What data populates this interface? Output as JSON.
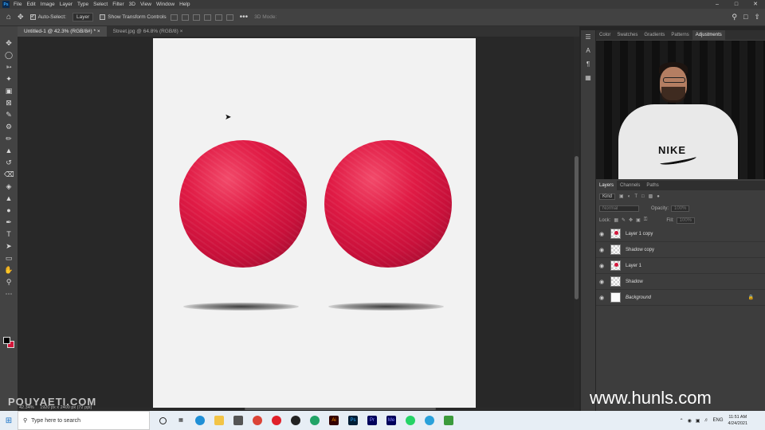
{
  "menubar": {
    "logo": "Ps",
    "items": [
      "File",
      "Edit",
      "Image",
      "Layer",
      "Type",
      "Select",
      "Filter",
      "3D",
      "View",
      "Window",
      "Help"
    ]
  },
  "options": {
    "auto_select_label": "Auto-Select:",
    "auto_select_value": "Layer",
    "show_transform_label": "Show Transform Controls",
    "mode_3d": "3D Mode:"
  },
  "tabs": [
    {
      "label": "Untitled-1 @ 42.3% (RGB/8#) *"
    },
    {
      "label": "Street.jpg @ 64.8% (RGB/8)"
    }
  ],
  "status": {
    "zoom": "42.34%",
    "dimensions": "1920 px x 2400 px (72 ppi)"
  },
  "right_panel_tabs": [
    "Color",
    "Swatches",
    "Gradients",
    "Patterns",
    "Adjustments"
  ],
  "webcam": {
    "shirt_text": "NIKE"
  },
  "layers_panel": {
    "tabs": [
      "Layers",
      "Channels",
      "Paths"
    ],
    "kind_label": "Kind",
    "blend_mode": "Normal",
    "opacity_label": "Opacity:",
    "opacity_value": "100%",
    "lock_label": "Lock:",
    "fill_label": "Fill:",
    "fill_value": "100%",
    "layers": [
      {
        "name": "Layer 1 copy"
      },
      {
        "name": "Shadow copy"
      },
      {
        "name": "Layer 1"
      },
      {
        "name": "Shadow"
      },
      {
        "name": "Background"
      }
    ]
  },
  "watermarks": {
    "left": "POUYAETI.COM",
    "right": "www.hunls.com"
  },
  "taskbar": {
    "search_placeholder": "Type here to search",
    "lang": "ENG",
    "time": "11:51 AM",
    "date": "4/24/2021"
  }
}
